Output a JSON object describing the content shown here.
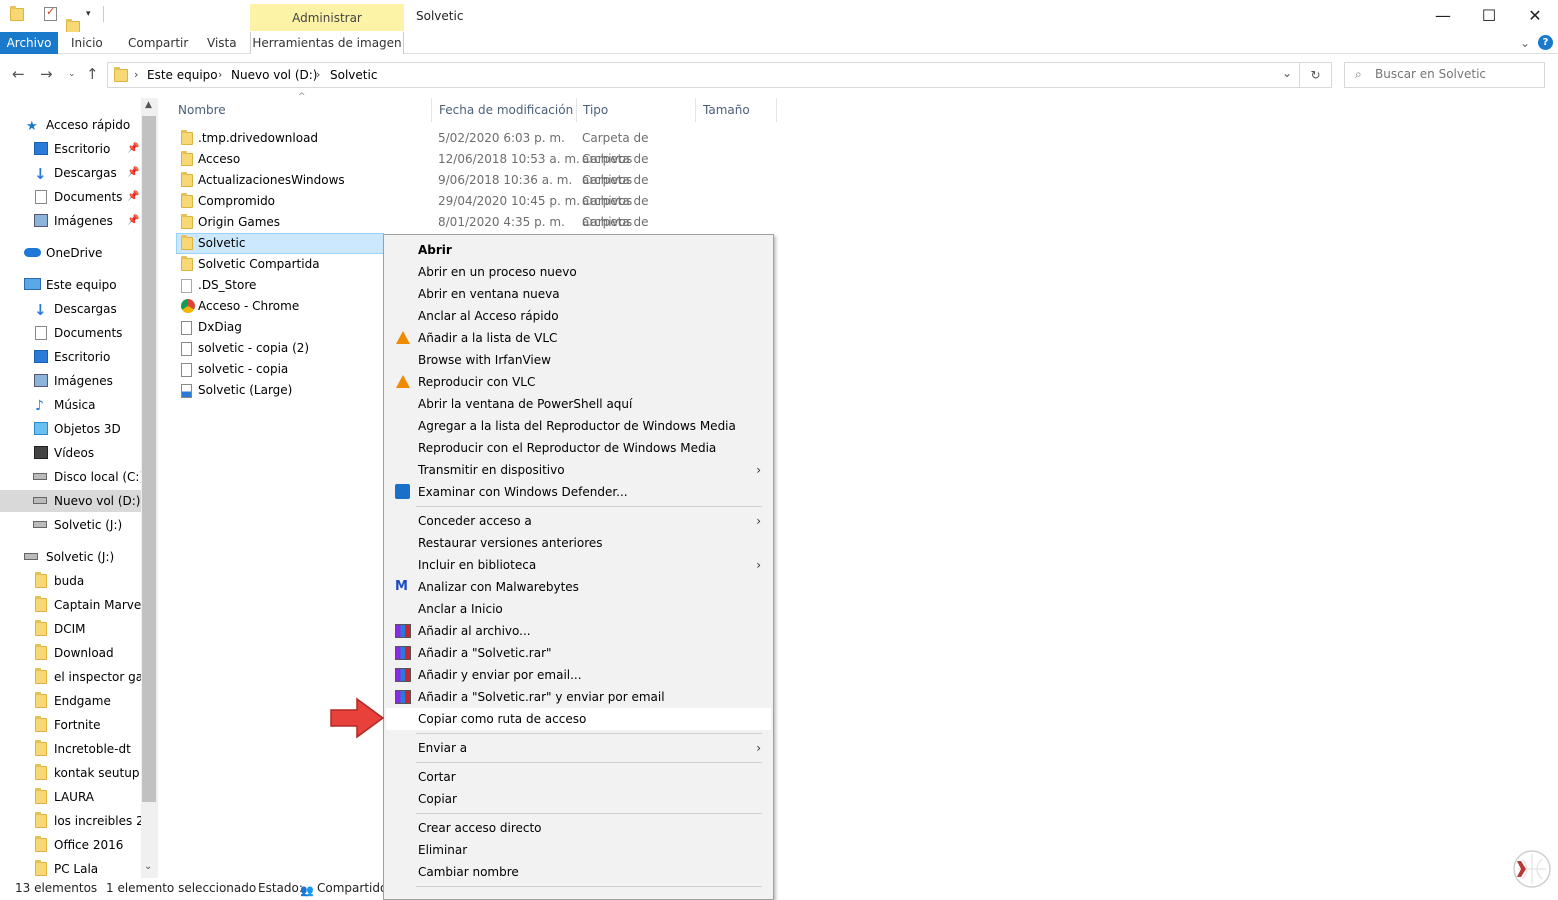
{
  "titlebar": {
    "tools_tab_label": "Administrar",
    "window_title": "Solvetic",
    "minimize": "—",
    "maximize": "☐",
    "close": "✕"
  },
  "ribbon": {
    "tabs": [
      "Archivo",
      "Inicio",
      "Compartir",
      "Vista",
      "Herramientas de imagen"
    ],
    "collapse": "⌄",
    "help": "?"
  },
  "address": {
    "crumbs": [
      "Este equipo",
      "Nuevo vol (D:)",
      "Solvetic"
    ],
    "dropdown": "⌄",
    "refresh": "↻"
  },
  "search": {
    "placeholder": "Buscar en Solvetic"
  },
  "sidebar": {
    "quick_access": "Acceso rápido",
    "quick_items": [
      "Escritorio",
      "Descargas",
      "Documents",
      "Imágenes"
    ],
    "onedrive": "OneDrive",
    "this_pc": "Este equipo",
    "pc_items": [
      "Descargas",
      "Documents",
      "Escritorio",
      "Imágenes",
      "Música",
      "Objetos 3D",
      "Vídeos",
      "Disco local (C:)",
      "Nuevo vol (D:)",
      "Solvetic (J:)"
    ],
    "drive_j": "Solvetic (J:)",
    "drive_items": [
      "buda",
      "Captain Marvel",
      "DCIM",
      "Download",
      "el inspector gadget",
      "Endgame",
      "Fortnite",
      "Incretoble-dt",
      "kontak seutup",
      "LAURA",
      "los increibles 2",
      "Office 2016",
      "PC Lala"
    ]
  },
  "columns": {
    "name": "Nombre",
    "modified": "Fecha de modificación",
    "type": "Tipo",
    "size": "Tamaño"
  },
  "files": [
    {
      "name": ".tmp.drivedownload",
      "date": "5/02/2020 6:03 p. m.",
      "type": "Carpeta de archivos",
      "icon": "folder"
    },
    {
      "name": "Acceso",
      "date": "12/06/2018 10:53 a. m.",
      "type": "Carpeta de archivos",
      "icon": "folder"
    },
    {
      "name": "ActualizacionesWindows",
      "date": "9/06/2018 10:36 a. m.",
      "type": "Carpeta de archivos",
      "icon": "folder"
    },
    {
      "name": "Compromido",
      "date": "29/04/2020 10:45 p. m.",
      "type": "Carpeta de archivos",
      "icon": "folder"
    },
    {
      "name": "Origin Games",
      "date": "8/01/2020 4:35 p. m.",
      "type": "Carpeta de archivos",
      "icon": "folder"
    },
    {
      "name": "Solvetic",
      "date": "",
      "type": "",
      "icon": "folder"
    },
    {
      "name": "Solvetic Compartida",
      "date": "",
      "type": "",
      "icon": "folder"
    },
    {
      "name": ".DS_Store",
      "date": "",
      "type": "",
      "icon": "file"
    },
    {
      "name": "Acceso - Chrome",
      "date": "",
      "type": "",
      "icon": "chrome"
    },
    {
      "name": "DxDiag",
      "date": "",
      "type": "",
      "icon": "doc"
    },
    {
      "name": "solvetic - copia (2)",
      "date": "",
      "type": "",
      "icon": "doc"
    },
    {
      "name": "solvetic - copia",
      "date": "",
      "type": "",
      "icon": "doc"
    },
    {
      "name": "Solvetic (Large)",
      "date": "",
      "type": "",
      "icon": "image"
    }
  ],
  "status": {
    "count": "13 elementos",
    "selected": "1 elemento seleccionado",
    "state_label": "Estado:",
    "state_value": "Compartido"
  },
  "context_menu": {
    "items": [
      {
        "label": "Abrir",
        "bold": true
      },
      {
        "label": "Abrir en un proceso nuevo"
      },
      {
        "label": "Abrir en ventana nueva"
      },
      {
        "label": "Anclar al Acceso rápido"
      },
      {
        "label": "Añadir a la lista de VLC",
        "icon": "vlc-icon"
      },
      {
        "label": "Browse with IrfanView"
      },
      {
        "label": "Reproducir con VLC",
        "icon": "vlc-icon"
      },
      {
        "label": "Abrir la ventana de PowerShell aquí"
      },
      {
        "label": "Agregar a la lista del Reproductor de Windows Media"
      },
      {
        "label": "Reproducir con el Reproductor de Windows Media"
      },
      {
        "label": "Transmitir en dispositivo",
        "submenu": true
      },
      {
        "label": "Examinar con Windows Defender...",
        "icon": "defender-icon"
      },
      {
        "label": "Conceder acceso a",
        "submenu": true
      },
      {
        "label": "Restaurar versiones anteriores"
      },
      {
        "label": "Incluir en biblioteca",
        "submenu": true
      },
      {
        "label": "Analizar con Malwarebytes",
        "icon": "malwarebytes-icon"
      },
      {
        "label": "Anclar a Inicio"
      },
      {
        "label": "Añadir al archivo...",
        "icon": "winrar-icon"
      },
      {
        "label": "Añadir a \"Solvetic.rar\"",
        "icon": "winrar-icon"
      },
      {
        "label": "Añadir y enviar por email...",
        "icon": "winrar-icon"
      },
      {
        "label": "Añadir a \"Solvetic.rar\" y enviar por email",
        "icon": "winrar-icon"
      },
      {
        "label": "Copiar como ruta de acceso",
        "highlighted": true
      },
      {
        "label": "Enviar a",
        "submenu": true
      },
      {
        "label": "Cortar"
      },
      {
        "label": "Copiar"
      },
      {
        "label": "Crear acceso directo"
      },
      {
        "label": "Eliminar"
      },
      {
        "label": "Cambiar nombre"
      }
    ],
    "submenu_arrow": "›"
  }
}
